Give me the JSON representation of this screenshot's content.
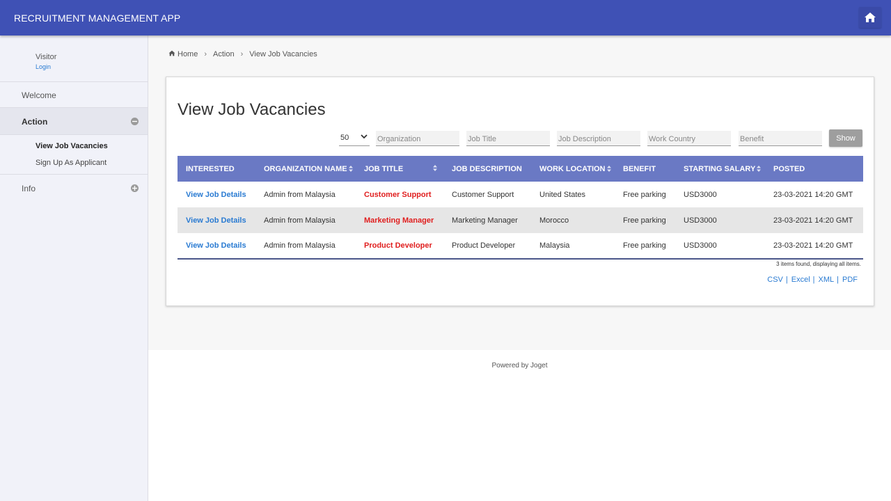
{
  "header": {
    "title": "RECRUITMENT MANAGEMENT APP"
  },
  "sidebar": {
    "user": {
      "name": "Visitor",
      "login_label": "Login"
    },
    "items": [
      {
        "label": "Welcome"
      },
      {
        "label": "Action",
        "sub_items": [
          {
            "label": "View Job Vacancies"
          },
          {
            "label": "Sign Up As Applicant"
          }
        ]
      },
      {
        "label": "Info"
      }
    ]
  },
  "breadcrumb": [
    "Home",
    "Action",
    "View Job Vacancies"
  ],
  "page": {
    "title": "View Job Vacancies"
  },
  "filters": {
    "page_size": "50",
    "organization_placeholder": "Organization",
    "job_title_placeholder": "Job Title",
    "job_description_placeholder": "Job Description",
    "work_country_placeholder": "Work Country",
    "benefit_placeholder": "Benefit",
    "show_label": "Show"
  },
  "table": {
    "columns": [
      "INTERESTED",
      "ORGANIZATION NAME",
      "JOB TITLE",
      "JOB DESCRIPTION",
      "WORK LOCATION",
      "BENEFIT",
      "STARTING SALARY",
      "POSTED"
    ],
    "rows": [
      {
        "interested": "View Job Details",
        "organization": "Admin from Malaysia",
        "job_title": "Customer Support",
        "job_description": "Customer Support",
        "work_location": "United States",
        "benefit": "Free parking",
        "salary": "USD3000",
        "posted": "23-03-2021 14:20 GMT"
      },
      {
        "interested": "View Job Details",
        "organization": "Admin from Malaysia",
        "job_title": "Marketing Manager",
        "job_description": "Marketing Manager",
        "work_location": "Morocco",
        "benefit": "Free parking",
        "salary": "USD3000",
        "posted": "23-03-2021 14:20 GMT"
      },
      {
        "interested": "View Job Details",
        "organization": "Admin from Malaysia",
        "job_title": "Product Developer",
        "job_description": "Product Developer",
        "work_location": "Malaysia",
        "benefit": "Free parking",
        "salary": "USD3000",
        "posted": "23-03-2021 14:20 GMT"
      }
    ],
    "summary": "3 items found, displaying all items.",
    "exports": [
      "CSV",
      "Excel",
      "XML",
      "PDF"
    ]
  },
  "footer": {
    "text": "Powered by Joget"
  },
  "colors": {
    "header_bg": "#3f51b5",
    "table_header_bg": "#6a79c4",
    "link": "#2a7bd2",
    "job_title": "#e01e1e"
  },
  "icons": {
    "home": "home-icon",
    "sort": "sort-icon",
    "collapse": "minus-circle-icon",
    "expand": "plus-circle-icon",
    "chevron": "chevron-down-icon"
  }
}
